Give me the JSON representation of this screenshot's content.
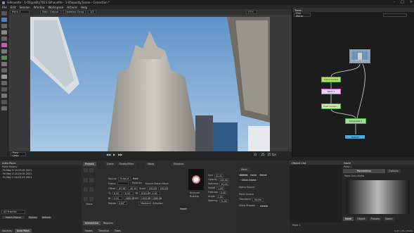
{
  "title_bar": {
    "title": "Silhouette - 1-05quality7023.Silhouette - 1-05quality.Scene - Conection *"
  },
  "menu": [
    "File",
    "Edit",
    "Session",
    "Window",
    "Workspace",
    "Actions",
    "Help"
  ],
  "viewer_toolbar": {
    "layer": "Paint 1",
    "output": "Main: Output",
    "update": "Updates: Drag",
    "scale": "1/2",
    "zoom": "57%"
  },
  "timeline": {
    "loop": "Play: Loop",
    "frame": "32",
    "end_frame": "25",
    "fps": "25 fps"
  },
  "trees_panel": {
    "title": "Trees",
    "tree_select": "Film Matte",
    "nodes": [
      "Source",
      "Luma Correct",
      "Paint 1",
      "Color Compo...",
      "Composite 1",
      "Output"
    ],
    "source_node_label": "Film Matte angle.mp4"
  },
  "auto_paint": {
    "title": "Auto Paint",
    "history_label": "Paint History",
    "items": [
      "Fri May 5 14:19:02 2021",
      "Fri May 5 14:23:05 2021",
      "Fri May 5 14:23:25 2021"
    ],
    "frames_select": "All Frames",
    "buttons": [
      "Match Moves",
      "Replay",
      "Refresh"
    ]
  },
  "paint_panel": {
    "tabs": [
      "Presets",
      "Clone",
      "Grade/Filter",
      "Warp",
      "Brushes"
    ],
    "source_label": "Source",
    "source_value": "Output",
    "hold_label": "Hold",
    "frame_label": "Frame",
    "offset_label": "Offset",
    "offset_x": "-97.58",
    "offset_y": "-40.19",
    "scale_label": "Scale",
    "scale_x": "100.00",
    "scale_y": "100.00",
    "tl_label": "TL",
    "tl_x": "0.00",
    "tl_y": "0.00",
    "tr_label": "TR",
    "tr_x": "1920.00",
    "tr_y": "0.00",
    "bl_label": "BL",
    "bl_x": "0.00",
    "bl_y": "1080.00",
    "br_label": "BR",
    "br_x": "1920.00",
    "br_y": "1080.00",
    "rotate_label": "Rotate",
    "rotate_value": "0.00°",
    "relative_label": "Relative",
    "source_move_label": "Source Match Move",
    "blend_select": "Masked",
    "subpixel_label": "Subpixel",
    "reset_label": "Reset",
    "bottom_tabs": [
      "Interactive",
      "Regions"
    ],
    "clone_label": "Clone",
    "brush_size_label": "Size",
    "brush_size": "41.41",
    "opacity_label": "Opacity",
    "opacity": "100.00",
    "softness_label": "Softness",
    "softness": "50.00",
    "falloff_label": "Falloff",
    "falloff": "1.00",
    "flatness_label": "Flatness",
    "flatness": "0.00",
    "angle_label": "Angle",
    "angle": "0.00",
    "spacing_label": "Spacing",
    "spacing": "75.00",
    "airbrush_label": "Airbrush",
    "buildup_label": "Buildup",
    "paint_label": "Paint",
    "mode_buttons": [
      "Normal",
      "Color",
      "Detail"
    ],
    "other_alpha": "Other Alpha",
    "alpha_source": "Alpha Source",
    "paint_source": "Paint Source",
    "transform_label": "Transform",
    "transform_value": "Alpha",
    "show_shapes": "Show Shapes",
    "delete_label": "Delete"
  },
  "object_list": {
    "title": "Object List",
    "item": "Paint 1"
  },
  "node_panel": {
    "title": "Node",
    "node_name": "Paint 1",
    "tabs": [
      "Parameters",
      "Options"
    ],
    "field": "Paint Only Alpha"
  },
  "bottom_tabs_left": [
    "Sources",
    "Auto Paint"
  ],
  "bottom_tabs_mid": [
    "Nodes",
    "Timeline",
    "Trees"
  ],
  "bottom_tabs_right": [
    "Node",
    "Object",
    "Presets",
    "Notes"
  ],
  "status_right": "5.47 ( 2% ) 8 bits",
  "colors": {
    "accent": "#5a9ad8",
    "node_green": "#3fb53f",
    "node_pink": "#d860c8"
  }
}
